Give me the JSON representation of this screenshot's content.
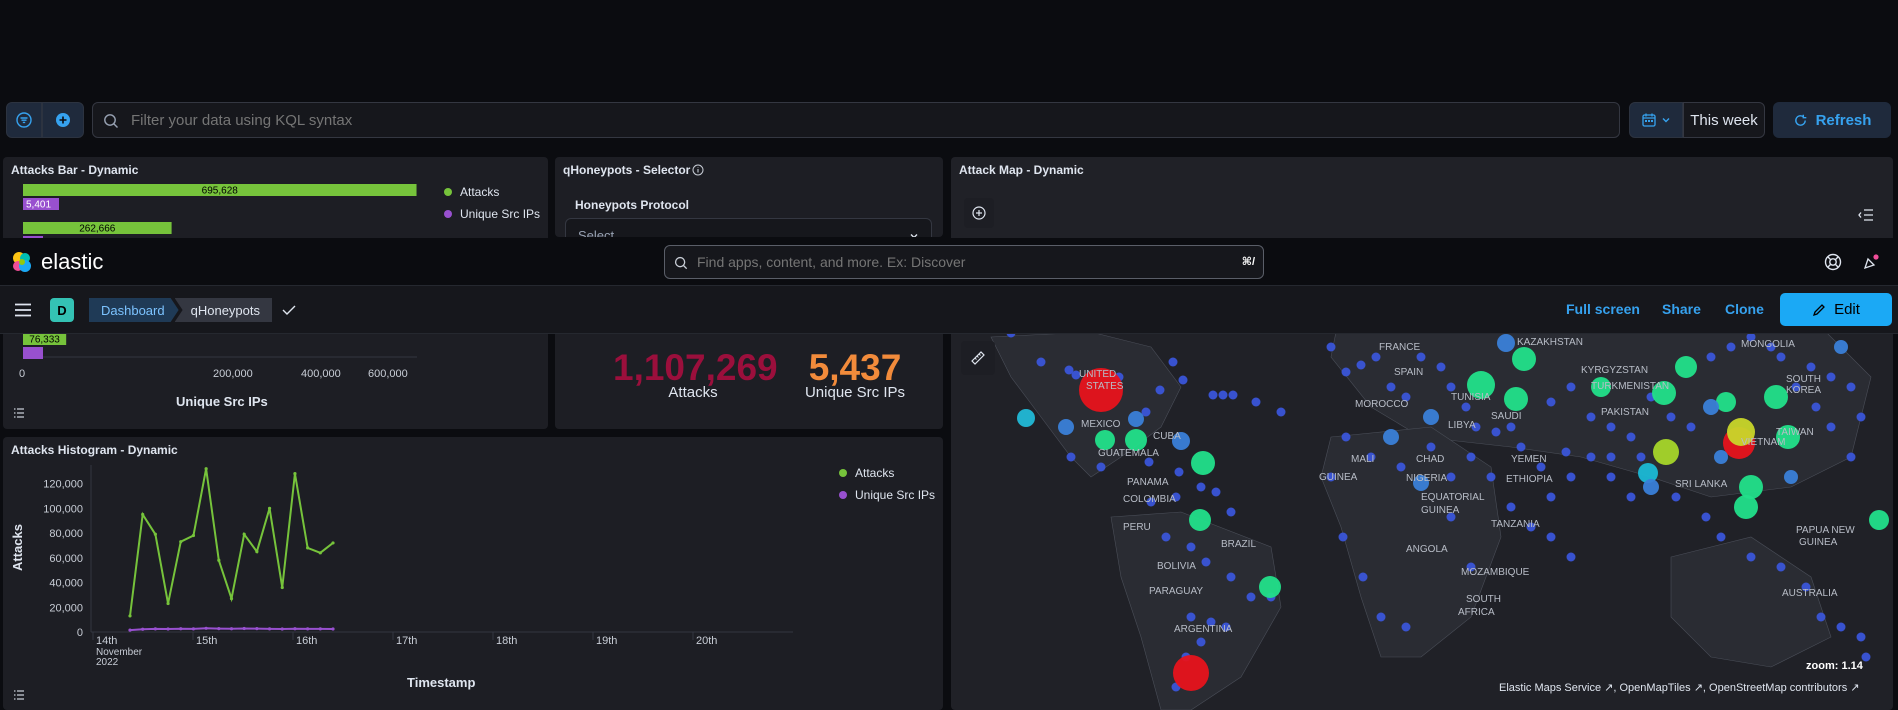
{
  "filter_bar": {
    "search_placeholder": "Filter your data using KQL syntax",
    "date_range": "This week",
    "refresh_label": "Refresh"
  },
  "header": {
    "brand": "elastic",
    "global_search_placeholder": "Find apps, content, and more. Ex: Discover",
    "shortcut": "⌘/",
    "space_letter": "D",
    "breadcrumbs": [
      "Dashboard",
      "qHoneypots"
    ],
    "actions": {
      "full_screen": "Full screen",
      "share": "Share",
      "clone": "Clone",
      "edit": "Edit"
    }
  },
  "panels": {
    "attacks_bar": {
      "title": "Attacks Bar - Dynamic",
      "legend": [
        "Attacks",
        "Unique Src IPs"
      ],
      "bar_labels": [
        "695,628",
        "5,401",
        "262,666",
        "76,333"
      ],
      "ticks": [
        "0",
        "200,000",
        "400,000",
        "600,000"
      ],
      "axis_label": "Unique Src IPs"
    },
    "selector": {
      "title": "qHoneypots - Selector",
      "label": "Honeypots Protocol",
      "select_placeholder": "Select..."
    },
    "metric": {
      "attacks_value": "1,107,269",
      "attacks_label": "Attacks",
      "ips_value": "5,437",
      "ips_label": "Unique Src IPs"
    },
    "histogram": {
      "title": "Attacks Histogram - Dynamic",
      "ylabel": "Attacks",
      "xlabel": "Timestamp",
      "legend": [
        "Attacks",
        "Unique Src IPs"
      ],
      "y_ticks": [
        "120,000",
        "100,000",
        "80,000",
        "60,000",
        "40,000",
        "20,000",
        "0"
      ],
      "x_ticks": [
        "14th",
        "15th",
        "16th",
        "17th",
        "18th",
        "19th",
        "20th"
      ],
      "x_sub": [
        "November",
        "2022"
      ]
    },
    "map": {
      "title": "Attack Map - Dynamic",
      "zoom_label": "zoom:",
      "zoom_value": "1.14",
      "attribution": [
        "Elastic Maps Service",
        "OpenMapTiles",
        "OpenStreetMap contributors"
      ],
      "places": [
        "FRANCE",
        "KAZAKHSTAN",
        "MONGOLIA",
        "SPAIN",
        "KYRGYZSTAN",
        "TUNISIA",
        "MOROCCO",
        "TURKMENISTAN",
        "LIBYA",
        "SAUDI",
        "PAKISTAN",
        "TAIWAN",
        "MALI",
        "CHAD",
        "YEMEN",
        "NIGERIA",
        "ETHIOPIA",
        "GUINEA",
        "SRI LANKA",
        "EQUATORIAL",
        "GUINEA",
        "TANZANIA",
        "ANGOLA",
        "MOZAMBIQUE",
        "SOUTH",
        "AFRICA",
        "AUSTRALIA",
        "PAPUA NEW",
        "GUINEA",
        "MEXICO",
        "CUBA",
        "GUATEMALA",
        "PANAMA",
        "COLOMBIA",
        "PERU",
        "BRAZIL",
        "BOLIVIA",
        "PARAGUAY",
        "ARGENTINA",
        "UNITED",
        "STATES",
        "SOUTH",
        "KOREA",
        "VIETNAM"
      ]
    }
  },
  "chart_data": [
    {
      "type": "bar",
      "title": "Attacks Bar - Dynamic",
      "xlabel": "Unique Src IPs",
      "series": [
        {
          "name": "Attacks",
          "values": [
            695628,
            262666,
            76333
          ]
        },
        {
          "name": "Unique Src IPs",
          "values": [
            5401,
            1800,
            900
          ]
        }
      ],
      "xlim": [
        0,
        700000
      ],
      "legend": "right"
    },
    {
      "type": "line",
      "title": "Attacks Histogram - Dynamic",
      "xlabel": "Timestamp",
      "ylabel": "Attacks",
      "x": [
        "14th 03:00",
        "14th 09:00",
        "14th 15:00",
        "14th 21:00",
        "15th 03:00",
        "15th 09:00",
        "15th 15:00",
        "15th 21:00",
        "16th 03:00",
        "16th 09:00",
        "16th 15:00",
        "16th 21:00",
        "17th 03:00"
      ],
      "series": [
        {
          "name": "Attacks",
          "values": [
            13000,
            95000,
            79000,
            23000,
            73000,
            78000,
            132000,
            58000,
            27000,
            79000,
            65000,
            100000,
            36000,
            128000,
            68000,
            64000,
            72000
          ]
        },
        {
          "name": "Unique Src IPs",
          "values": [
            300,
            450,
            500,
            480,
            520,
            510,
            600,
            540,
            520,
            560,
            540,
            500,
            480,
            520,
            500,
            510,
            490
          ]
        }
      ],
      "ylim": [
        0,
        135000
      ],
      "legend": "top-right"
    }
  ]
}
